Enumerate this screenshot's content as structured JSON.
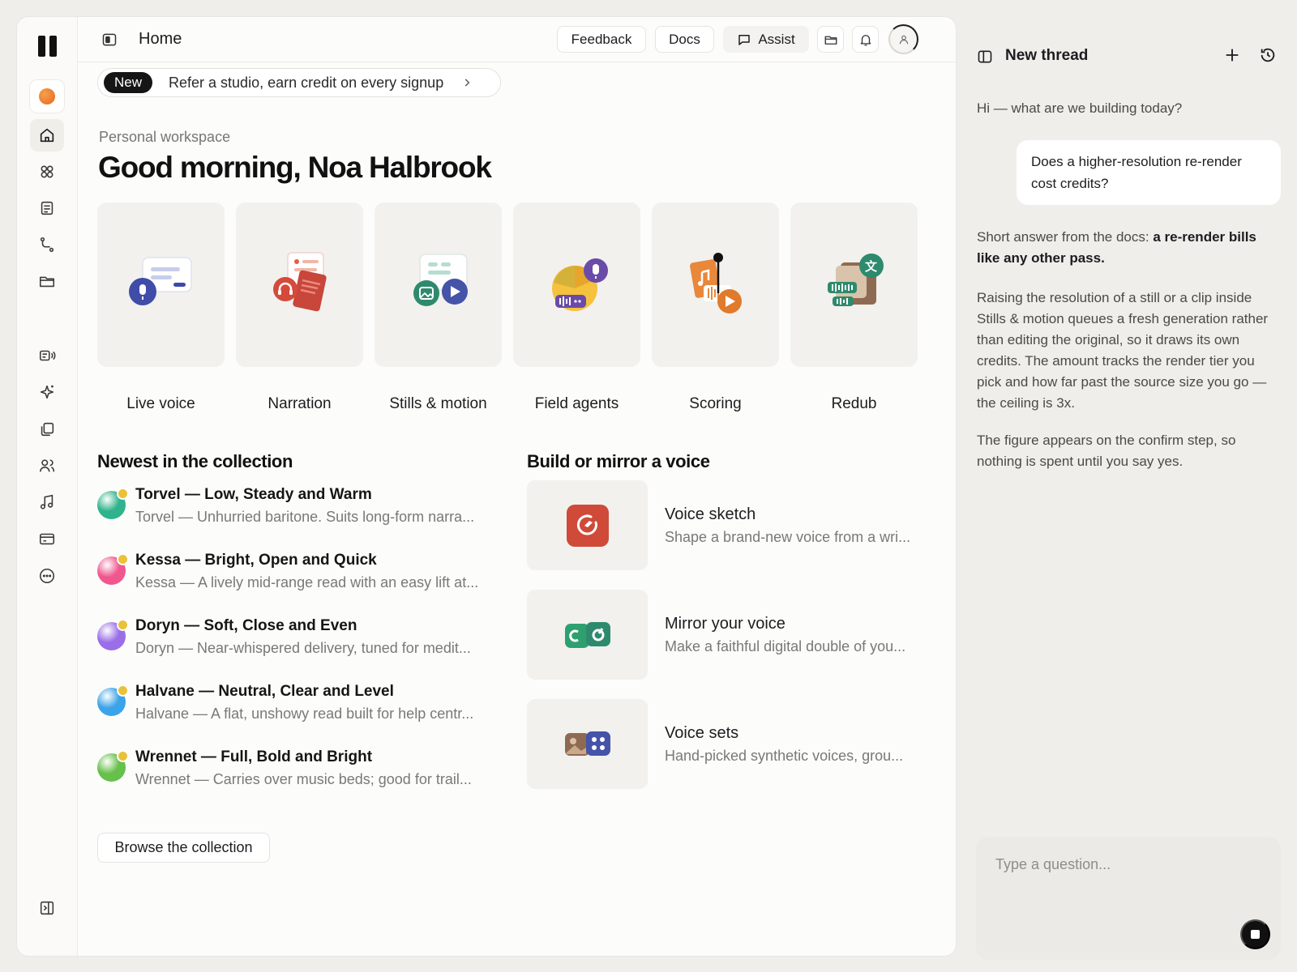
{
  "header": {
    "title": "Home",
    "buttons": {
      "feedback": "Feedback",
      "docs": "Docs",
      "assist": "Assist"
    }
  },
  "banner": {
    "tag": "New",
    "text": "Refer a studio, earn credit on every signup"
  },
  "workspace_label": "Personal workspace",
  "greeting": "Good morning, Noa Halbrook",
  "tools": [
    {
      "label": "Live voice"
    },
    {
      "label": "Narration"
    },
    {
      "label": "Stills & motion"
    },
    {
      "label": "Field agents"
    },
    {
      "label": "Scoring"
    },
    {
      "label": "Redub"
    }
  ],
  "collection": {
    "title": "Newest in the collection",
    "browse_label": "Browse the collection",
    "voices": [
      {
        "name": "Torvel — Low, Steady and Warm",
        "desc": "Torvel — Unhurried baritone. Suits long-form narra...",
        "color": "#2fb38c"
      },
      {
        "name": "Kessa — Bright, Open and Quick",
        "desc": "Kessa — A lively mid-range read with an easy lift at...",
        "color": "#f0578e"
      },
      {
        "name": "Doryn — Soft, Close and Even",
        "desc": "Doryn — Near-whispered delivery, tuned for medit...",
        "color": "#9a6ee8"
      },
      {
        "name": "Halvane — Neutral, Clear and Level",
        "desc": "Halvane — A flat, unshowy read built for help centr...",
        "color": "#3aa3ea"
      },
      {
        "name": "Wrennet — Full, Bold and Bright",
        "desc": "Wrennet — Carries over music beds; good for trail...",
        "color": "#66c04a"
      }
    ]
  },
  "build": {
    "title": "Build or mirror a voice",
    "items": [
      {
        "name": "Voice sketch",
        "desc": "Shape a brand-new voice from a wri..."
      },
      {
        "name": "Mirror your voice",
        "desc": "Make a faithful digital double of you..."
      },
      {
        "name": "Voice sets",
        "desc": "Hand-picked synthetic voices, grou..."
      }
    ]
  },
  "assistant": {
    "title": "New thread",
    "greeting": "Hi — what are we building today?",
    "user_message": "Does a higher-resolution re-render cost credits?",
    "reply_lead": "Short answer from the docs: ",
    "reply_bold": "a re-render bills like any other pass.",
    "reply_p2": "Raising the resolution of a still or a clip inside Stills & motion queues a fresh generation rather than editing the original, so it draws its own credits. The amount tracks the render tier you pick and how far past the source size you go — the ceiling is 3x.",
    "reply_p3": "The figure appears on the confirm step, so nothing is spent until you say yes.",
    "input_placeholder": "Type a question..."
  }
}
